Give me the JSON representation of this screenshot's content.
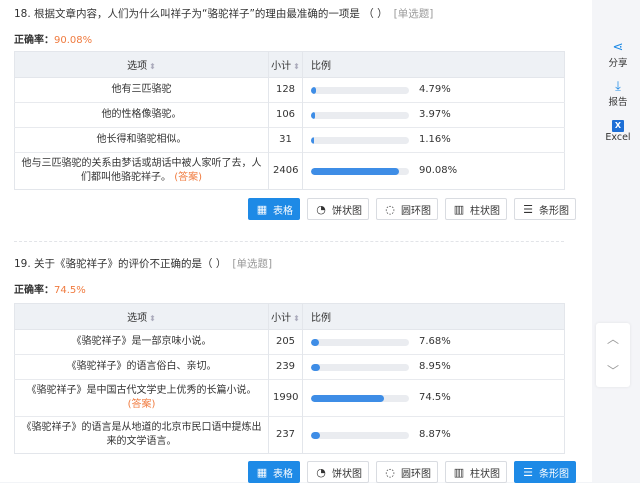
{
  "q18": {
    "title": "18. 根据文章内容，人们为什么叫祥子为“骆驼祥子”的理由最准确的一项是 （  ）",
    "type_tag": "[单选题]",
    "rate_label": "正确率：",
    "rate_value": "90.08%",
    "headers": {
      "option": "选项",
      "count": "小计",
      "percent": "比例"
    },
    "rows": [
      {
        "option": "他有三匹骆驼",
        "answer": "",
        "count": "128",
        "percent": "4.79%",
        "fraction": 0.0479
      },
      {
        "option": "他的性格像骆驼。",
        "answer": "",
        "count": "106",
        "percent": "3.97%",
        "fraction": 0.0397
      },
      {
        "option": "他长得和骆驼相似。",
        "answer": "",
        "count": "31",
        "percent": "1.16%",
        "fraction": 0.0116
      },
      {
        "option": "他与三匹骆驼的关系由梦话或胡话中被人家听了去，人们都叫他骆驼祥子。",
        "answer": "(答案)",
        "count": "2406",
        "percent": "90.08%",
        "fraction": 0.9008
      }
    ],
    "buttons": [
      {
        "label": "表格",
        "icon": "table-icon",
        "active": true
      },
      {
        "label": "饼状图",
        "icon": "pie-icon",
        "active": false
      },
      {
        "label": "圆环图",
        "icon": "donut-icon",
        "active": false
      },
      {
        "label": "柱状图",
        "icon": "column-icon",
        "active": false
      },
      {
        "label": "条形图",
        "icon": "bar-icon",
        "active": false
      }
    ]
  },
  "q19": {
    "title": "19. 关于《骆驼祥子》的评价不正确的是（ ）",
    "type_tag": "[单选题]",
    "rate_label": "正确率：",
    "rate_value": "74.5%",
    "headers": {
      "option": "选项",
      "count": "小计",
      "percent": "比例"
    },
    "rows": [
      {
        "option": "《骆驼祥子》是一部京味小说。",
        "answer": "",
        "count": "205",
        "percent": "7.68%",
        "fraction": 0.0768
      },
      {
        "option": "《骆驼祥子》的语言俗白、亲切。",
        "answer": "",
        "count": "239",
        "percent": "8.95%",
        "fraction": 0.0895
      },
      {
        "option": "《骆驼祥子》是中国古代文学史上优秀的长篇小说。",
        "answer": "(答案)",
        "count": "1990",
        "percent": "74.5%",
        "fraction": 0.745
      },
      {
        "option": "《骆驼祥子》的语言是从地道的北京市民口语中提炼出来的文学语言。",
        "answer": "",
        "count": "237",
        "percent": "8.87%",
        "fraction": 0.0887
      }
    ],
    "buttons": [
      {
        "label": "表格",
        "icon": "table-icon",
        "active": true
      },
      {
        "label": "饼状图",
        "icon": "pie-icon",
        "active": false
      },
      {
        "label": "圆环图",
        "icon": "donut-icon",
        "active": false
      },
      {
        "label": "柱状图",
        "icon": "column-icon",
        "active": false
      },
      {
        "label": "条形图",
        "icon": "bar-icon",
        "active": true
      }
    ]
  },
  "sidebar": {
    "share": {
      "label": "分享",
      "icon": "share-icon"
    },
    "report": {
      "label": "报告",
      "icon": "download-icon"
    },
    "excel": {
      "label": "Excel",
      "icon": "excel-icon",
      "glyph": "X"
    }
  },
  "colors": {
    "accent": "#1e8ae6",
    "answer": "#f07b3f",
    "bar": "#3e8de6"
  }
}
